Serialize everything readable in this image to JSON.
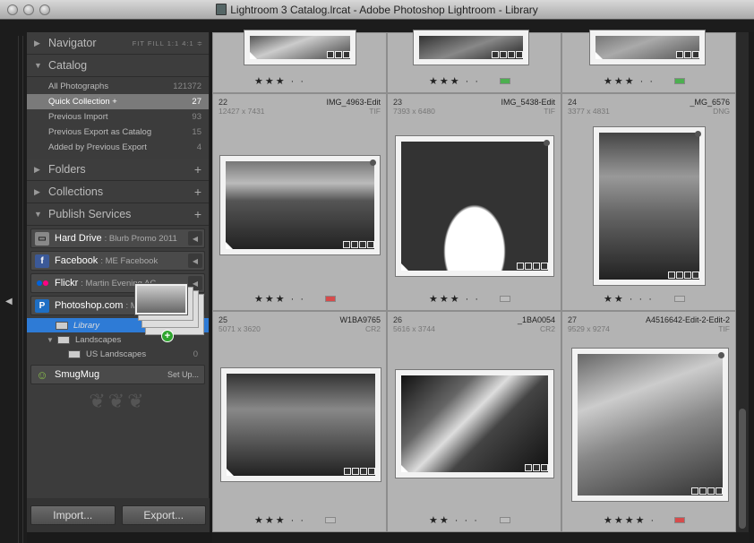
{
  "window": {
    "title": "Lightroom 3 Catalog.lrcat - Adobe Photoshop Lightroom - Library"
  },
  "navigator": {
    "label": "Navigator",
    "options": "FIT  FILL  1:1  4:1 ≑"
  },
  "catalog": {
    "label": "Catalog",
    "items": [
      {
        "label": "All Photographs",
        "count": "121372"
      },
      {
        "label": "Quick Collection +",
        "count": "27"
      },
      {
        "label": "Previous Import",
        "count": "93"
      },
      {
        "label": "Previous Export as Catalog",
        "count": "15"
      },
      {
        "label": "Added by Previous Export",
        "count": "4"
      }
    ]
  },
  "folders": {
    "label": "Folders"
  },
  "collections": {
    "label": "Collections"
  },
  "publish": {
    "label": "Publish Services",
    "services": [
      {
        "name": "Hard Drive",
        "sub": ": Blurb Promo 2011"
      },
      {
        "name": "Facebook",
        "sub": ": ME Facebook"
      },
      {
        "name": "Flickr",
        "sub": ": Martin Evening AC"
      },
      {
        "name": "Photoshop.com",
        "sub": ": M"
      }
    ],
    "ps_children": [
      {
        "label": "Library"
      },
      {
        "label": "Landscapes"
      },
      {
        "label": "US Landscapes",
        "count": "0"
      }
    ],
    "smugmug": {
      "name": "SmugMug",
      "action": "Set Up..."
    }
  },
  "buttons": {
    "import": "Import...",
    "export": "Export..."
  },
  "top_row": [
    {
      "stars": "★★★ ·  ·",
      "label_color": "#d7d7d7"
    },
    {
      "stars": "★★★ ·  ·",
      "label_color": "#4caf50"
    },
    {
      "stars": "★★★ ·  ·",
      "label_color": "#4caf50"
    }
  ],
  "cells": [
    {
      "num": "22",
      "dims": "12427 x 7431",
      "file": "IMG_4963-Edit",
      "ext": "TIF",
      "stars": "★★★ ·  ·",
      "label_color": "#d64b4b"
    },
    {
      "num": "23",
      "dims": "7393 x 6480",
      "file": "IMG_5438-Edit",
      "ext": "TIF",
      "stars": "★★★ ·  ·",
      "label_color": "#bdbdbd"
    },
    {
      "num": "24",
      "dims": "3377 x 4831",
      "file": "_MG_6576",
      "ext": "DNG",
      "stars": "★★ ·  ·  ·",
      "label_color": "#bdbdbd"
    },
    {
      "num": "25",
      "dims": "5071 x 3620",
      "file": "W1BA9765",
      "ext": "CR2",
      "stars": "★★★ ·  ·",
      "label_color": "#bdbdbd"
    },
    {
      "num": "26",
      "dims": "5616 x 3744",
      "file": "_1BA0054",
      "ext": "CR2",
      "stars": "★★ ·  ·  ·",
      "label_color": "#bdbdbd"
    },
    {
      "num": "27",
      "dims": "9529 x 9274",
      "file": "A4516642-Edit-2-Edit-2",
      "ext": "TIF",
      "stars": "★★★★ ·",
      "label_color": "#d64b4b"
    }
  ]
}
